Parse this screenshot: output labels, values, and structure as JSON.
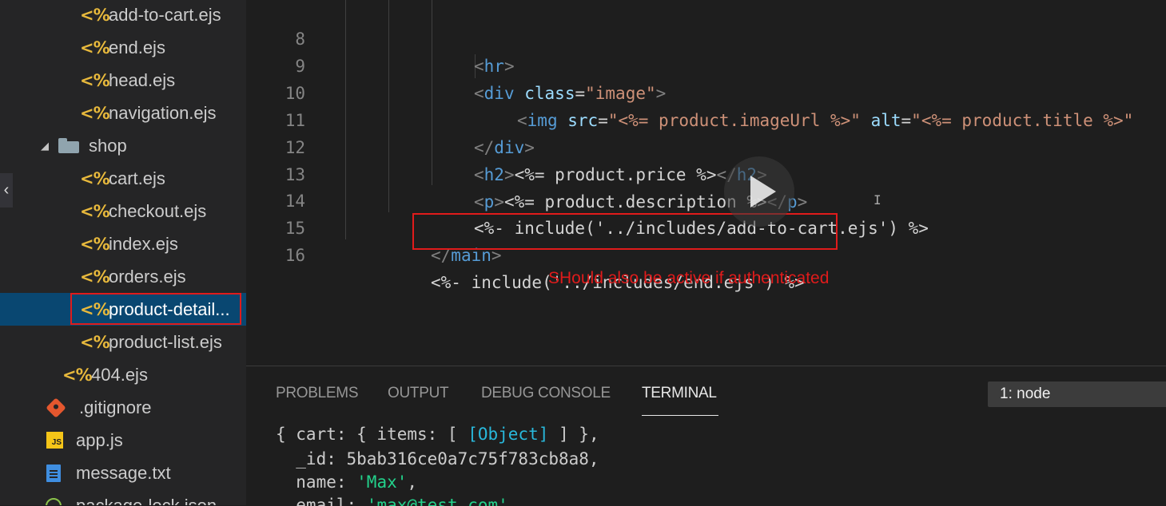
{
  "sidebar": {
    "items": [
      {
        "label": "add-to-cart.ejs",
        "icon": "ejs-icon"
      },
      {
        "label": "end.ejs",
        "icon": "ejs-icon"
      },
      {
        "label": "head.ejs",
        "icon": "ejs-icon"
      },
      {
        "label": "navigation.ejs",
        "icon": "ejs-icon"
      },
      {
        "label": "shop",
        "icon": "folder-icon"
      },
      {
        "label": "cart.ejs",
        "icon": "ejs-icon"
      },
      {
        "label": "checkout.ejs",
        "icon": "ejs-icon"
      },
      {
        "label": "index.ejs",
        "icon": "ejs-icon"
      },
      {
        "label": "orders.ejs",
        "icon": "ejs-icon"
      },
      {
        "label": "product-detail...",
        "icon": "ejs-icon"
      },
      {
        "label": "product-list.ejs",
        "icon": "ejs-icon"
      },
      {
        "label": "404.ejs",
        "icon": "ejs-icon"
      },
      {
        "label": ".gitignore",
        "icon": "git-icon"
      },
      {
        "label": "app.js",
        "icon": "js-icon"
      },
      {
        "label": "message.txt",
        "icon": "file-icon"
      },
      {
        "label": "package-lock.json",
        "icon": "package-icon"
      }
    ],
    "ejs_glyph": "<%",
    "js_glyph": "JS"
  },
  "editor": {
    "line_numbers": [
      "8",
      "9",
      "10",
      "11",
      "12",
      "13",
      "14",
      "15",
      "16"
    ],
    "code": {
      "l8_tag": "hr",
      "l9_tag": "div",
      "l9_attr": "class",
      "l9_val": "\"image\"",
      "l10_tag": "img",
      "l10_attr1": "src",
      "l10_val1": "\"<%= product.imageUrl %>\"",
      "l10_attr2": "alt",
      "l10_val2": "\"<%= product.title %>\"",
      "l11_tag": "div",
      "l12_tag": "h2",
      "l12_ejs": "<%= product.price %>",
      "l13_tag": "p",
      "l13_ejs": "<%= product.description %>",
      "l14_ejs": "<%- include('../includes/add-to-cart.ejs') %>",
      "l15_tag": "main",
      "l16_ejs": "<%- include('../includes/end.ejs') %>"
    },
    "annotation": "SHould also be active if authenticated"
  },
  "panel": {
    "tabs": [
      "PROBLEMS",
      "OUTPUT",
      "DEBUG CONSOLE",
      "TERMINAL"
    ],
    "active_tab": "TERMINAL",
    "terminal_select": "1: node",
    "terminal": {
      "l1_a": "{ cart: { items: [ ",
      "l1_obj": "[Object]",
      "l1_b": " ] },",
      "l2": "  _id: 5bab316ce0a7c75f783cb8a8,",
      "l3_key": "  name: ",
      "l3_val": "'Max'",
      "l3_end": ",",
      "l4_key": "  email: ",
      "l4_val": "'max@test.com'"
    }
  },
  "colors": {
    "selection": "#094771",
    "highlight_box": "#e01b1b",
    "ejs_icon": "#e8b93c"
  }
}
